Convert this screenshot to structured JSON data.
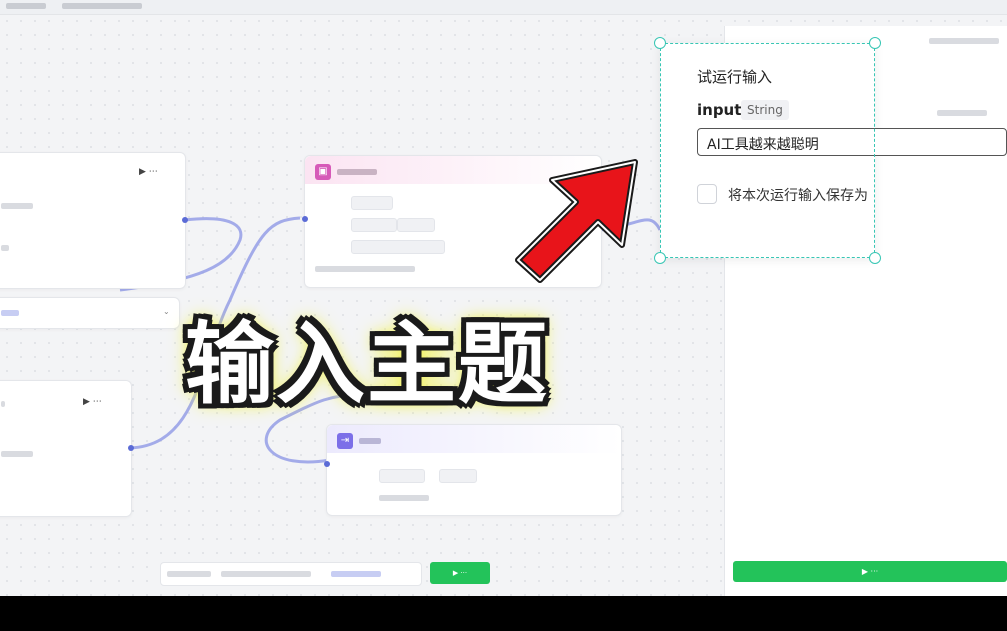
{
  "popup": {
    "title": "试运行输入",
    "param_name": "input",
    "param_type": "String",
    "input_value": "AI工具越来越聪明",
    "checkbox_label": "将本次运行输入保存为",
    "checkbox_checked": false
  },
  "overlay_caption": "输入主题",
  "colors": {
    "accent_green": "#23c35a",
    "selection_teal": "#37c6b4",
    "arrow_red": "#e8141a",
    "image_node_pink": "#f2a6d8",
    "end_node_purple": "#7c6fe8"
  },
  "icons": {
    "image_node": "image-gen-icon",
    "end_node": "end-icon",
    "pointer": "red-arrow-pointer"
  }
}
